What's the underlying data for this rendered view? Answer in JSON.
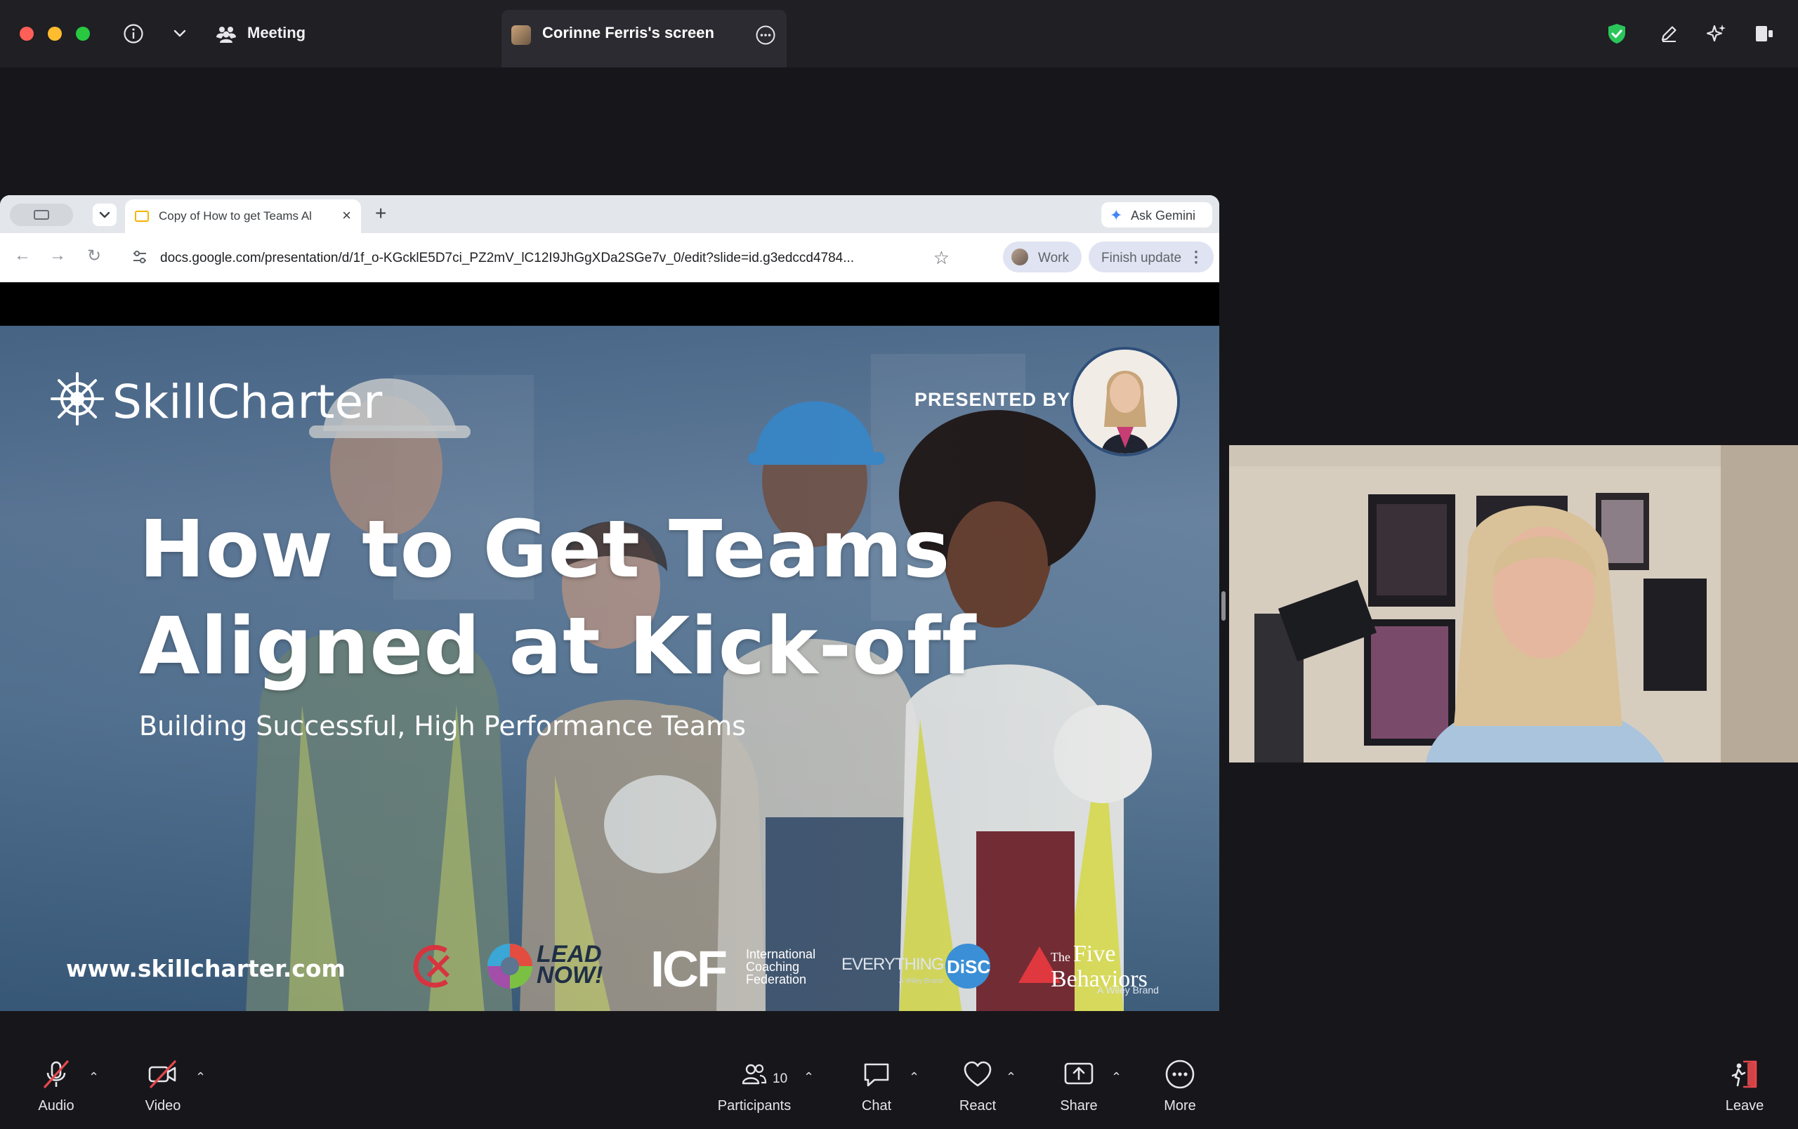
{
  "window": {
    "meeting_label": "Meeting",
    "screen_tab_title": "Corinne Ferris's screen"
  },
  "browser": {
    "tab_title": "Copy of How to get Teams Al",
    "ask_gemini": "Ask Gemini",
    "url": "docs.google.com/presentation/d/1f_o-KGcklE5D7ci_PZ2mV_lC12I9JhGgXDa2SGe7v_0/edit?slide=id.g3edccd4784...",
    "profile_label": "Work",
    "finish_update": "Finish update"
  },
  "slide": {
    "brand": "SkillCharter",
    "presented_by": "PRESENTED BY:",
    "headline_line1": "How to Get Teams",
    "headline_line2": "Aligned at Kick-off",
    "subhead": "Building Successful, High Performance Teams",
    "website": "www.skillcharter.com",
    "partners": {
      "leadnow_line1": "LEAD",
      "leadnow_line2": "NOW!",
      "icf": "ICF",
      "icf_line1": "International",
      "icf_line2": "Coaching",
      "icf_line3": "Federation",
      "disc_prefix": "EVERYTHING",
      "disc": "DiSC",
      "disc_sub": "A Wiley Brand",
      "five_the": "The",
      "five_line1": "Five",
      "five_line2": "Behaviors",
      "five_sub": "A Wiley Brand"
    }
  },
  "toolbar": {
    "audio": "Audio",
    "video": "Video",
    "participants": "Participants",
    "participants_count": "10",
    "chat": "Chat",
    "react": "React",
    "share": "Share",
    "more": "More",
    "leave": "Leave"
  },
  "colors": {
    "app_bg": "#17171b",
    "topbar_bg": "#1f1f24",
    "security_green": "#2bc65a",
    "leave_red": "#e5484d",
    "muted_slash": "#e5484d"
  },
  "icons": [
    "info-icon",
    "chevron-down-icon",
    "meeting-icon",
    "more-circle-icon",
    "shield-check-icon",
    "pencil-icon",
    "sparkle-icon",
    "side-panel-icon",
    "mic-muted-icon",
    "camera-muted-icon",
    "participants-icon",
    "chat-icon",
    "heart-icon",
    "share-screen-icon",
    "more-icon",
    "leave-icon"
  ]
}
